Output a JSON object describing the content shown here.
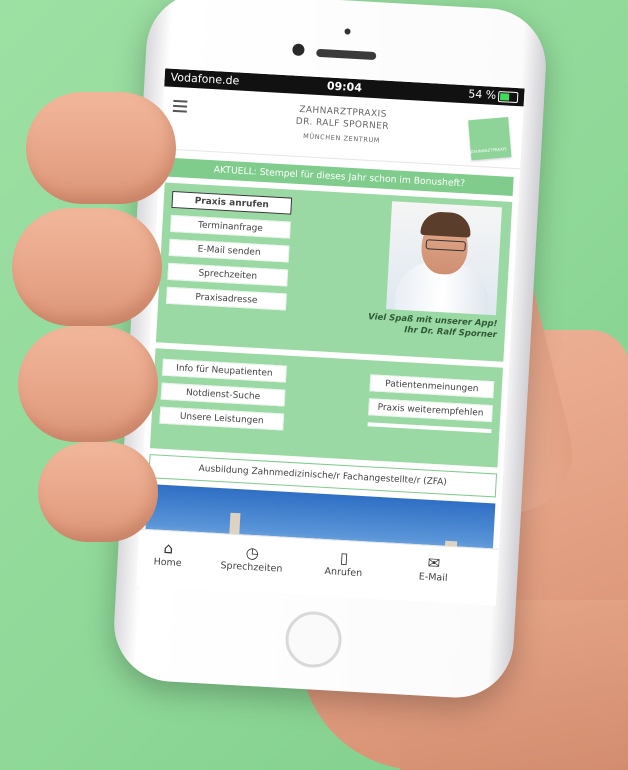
{
  "status_bar": {
    "carrier": "Vodafone.de",
    "time": "09:04",
    "battery": "54 %"
  },
  "header": {
    "line1": "ZAHNARZTPRAXIS",
    "line2": "DR. RALF SPORNER",
    "line3": "MÜNCHEN ZENTRUM",
    "logo_text": "ZAHNARZTPRAXIS"
  },
  "news": "AKTUELL: Stempel für dieses Jahr schon im Bonusheft?",
  "main_buttons": [
    "Praxis anrufen",
    "Terminanfrage",
    "E-Mail senden",
    "Sprechzeiten",
    "Praxisadresse"
  ],
  "quote": {
    "line1": "Viel Spaß mit unserer App!",
    "line2": "Ihr Dr. Ralf Sporner"
  },
  "info_left": [
    "Info für Neupatienten",
    "Notdienst-Suche",
    "Unsere Leistungen"
  ],
  "info_right": [
    "Patientenmeinungen",
    "Praxis weiterempfehlen"
  ],
  "training": "Ausbildung Zahnmedizinische/r Fachangestellte/r (ZFA)",
  "nav": [
    {
      "icon": "home-icon",
      "label": "Home"
    },
    {
      "icon": "clock-icon",
      "label": "Sprechzeiten"
    },
    {
      "icon": "phone-icon",
      "label": "Anrufen"
    },
    {
      "icon": "mail-icon",
      "label": "E-Mail"
    }
  ],
  "colors": {
    "background": "#9de0a3",
    "accent": "#7fcc8c",
    "panel": "#9bd9a4"
  }
}
